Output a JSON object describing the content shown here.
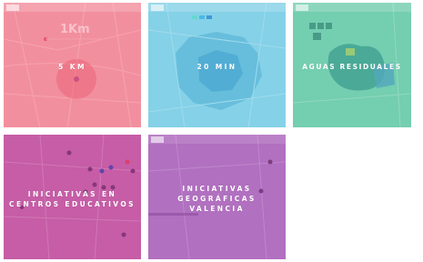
{
  "tiles": [
    {
      "id": "5km",
      "label": "5 KM",
      "overlay_color": "#f07a8c",
      "map_annotation": "1Km"
    },
    {
      "id": "20min",
      "label": "20 MIN",
      "overlay_color": "#6fc8e0"
    },
    {
      "id": "aguas",
      "label": "AGUAS RESIDUALES",
      "overlay_color": "#5cc3a3"
    },
    {
      "id": "centros",
      "label": "INICIATIVAS EN\nCENTROS EDUCATIVOS",
      "overlay_color": "#c14fa0"
    },
    {
      "id": "geograficas",
      "label": "INICIATIVAS\nGEOGRÁFICAS\nVALENCIA",
      "overlay_color": "#a95fb6"
    }
  ]
}
